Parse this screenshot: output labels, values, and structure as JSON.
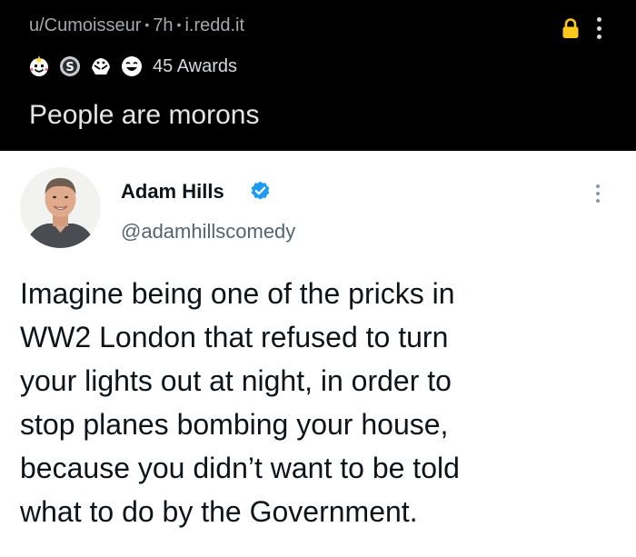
{
  "post": {
    "author": "u/Cumoisseur",
    "age": "7h",
    "domain": "i.redd.it",
    "awards_label": "45 Awards",
    "title": "People are morons",
    "icons": {
      "lock": "lock-icon",
      "overflow": "more-vertical-icon",
      "awards": [
        "wholesome-award-icon",
        "silver-award-icon",
        "hugz-award-icon",
        "laughing-award-icon"
      ]
    }
  },
  "tweet": {
    "name": "Adam Hills",
    "handle": "@adamhillscomedy",
    "verified": true,
    "lines": [
      "Imagine being one of the pricks in",
      "WW2 London that refused to turn",
      "your lights out at night, in order to",
      "stop planes bombing your house,",
      "because you didn’t want to be told",
      "what to do by the Government."
    ],
    "icons": {
      "avatar": "avatar",
      "verified": "verified-badge-icon",
      "overflow": "more-vertical-icon"
    }
  },
  "colors": {
    "reddit_bg": "#000000",
    "reddit_text": "#d7dadc",
    "meta_text": "#a6a8ab",
    "lock": "#ffc81e",
    "tweet_bg": "#ffffff",
    "tweet_text": "#0f1419",
    "handle_text": "#536471",
    "verified": "#1d9bf0"
  }
}
